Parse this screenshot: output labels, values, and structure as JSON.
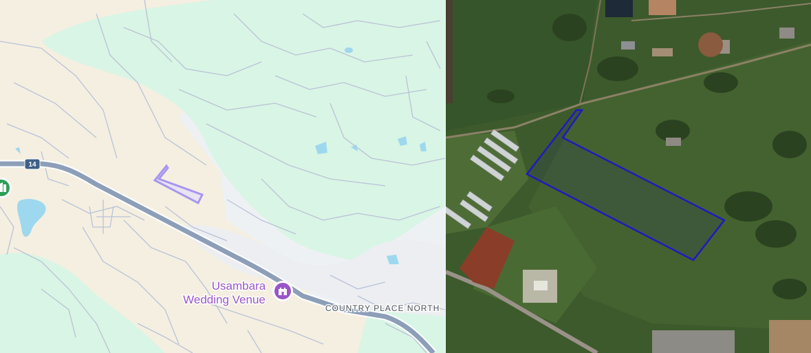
{
  "map_view": {
    "route_shield": "14",
    "poi": {
      "name_line1": "Usambara",
      "name_line2": "Wedding Venue",
      "icon": "venue-castle-icon",
      "color": "#9a55c9"
    },
    "road_label": "COUNTRY PLACE NORTH",
    "parcel_color": "#9e8ff0",
    "park_icon": "park-icon"
  },
  "satellite_view": {
    "parcel_color": "#1d1bbf"
  }
}
